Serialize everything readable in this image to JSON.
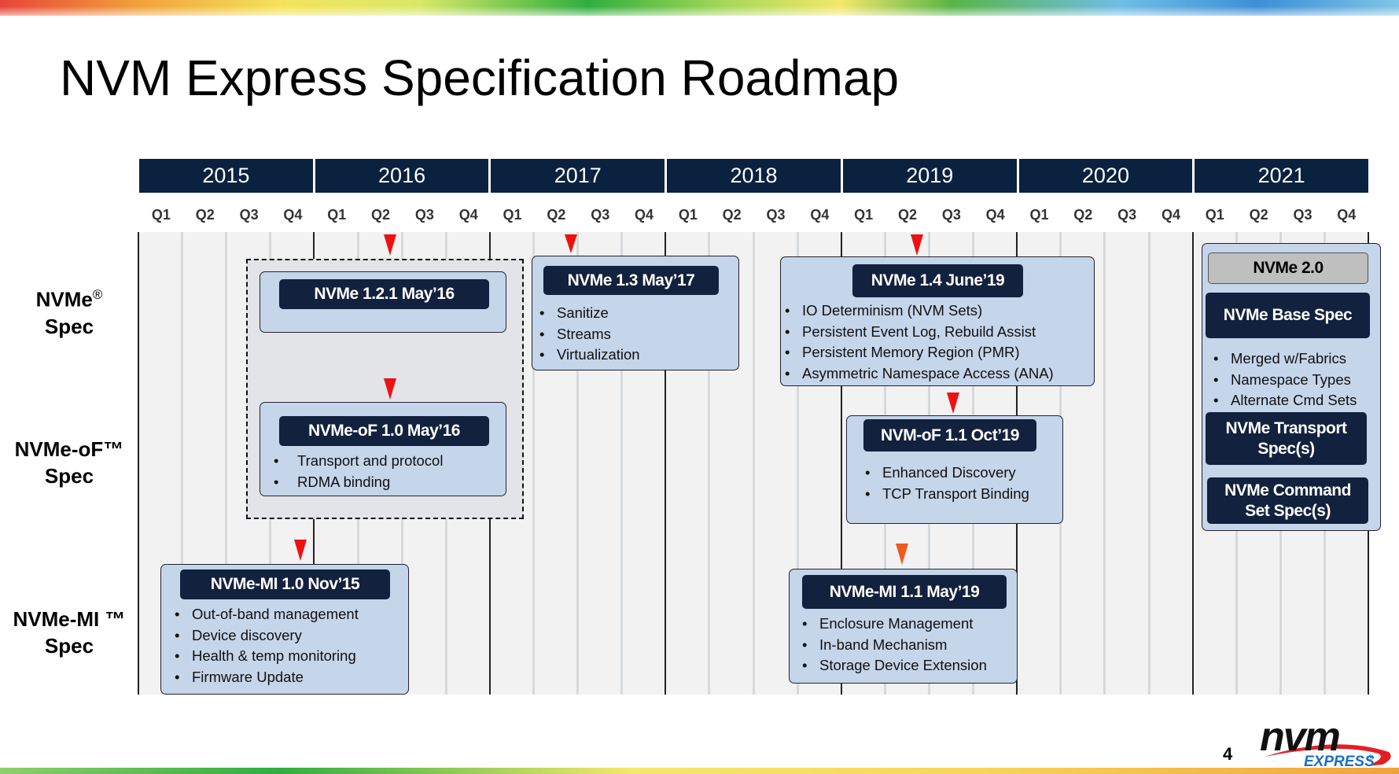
{
  "title": "NVM Express Specification Roadmap",
  "years": [
    "2015",
    "2016",
    "2017",
    "2018",
    "2019",
    "2020",
    "2021"
  ],
  "quarters": [
    "Q1",
    "Q2",
    "Q3",
    "Q4"
  ],
  "rows": {
    "nvme": {
      "name": "NVMe",
      "mark": "®",
      "line2": "Spec"
    },
    "nvmeof": {
      "name": "NVMe-oF™",
      "line2": "Spec"
    },
    "nvmemi": {
      "name": "NVMe-MI ™",
      "line2": "Spec"
    }
  },
  "releases": {
    "nvme_121": {
      "label": "NVMe 1.2.1 May’16",
      "bullets": []
    },
    "nvmeof_10": {
      "label": "NVMe-oF 1.0 May’16",
      "bullets": [
        "Transport and protocol",
        "RDMA binding"
      ]
    },
    "nvme_13": {
      "label": "NVMe 1.3 May’17",
      "bullets": [
        "Sanitize",
        "Streams",
        "Virtualization"
      ]
    },
    "nvme_14": {
      "label": "NVMe 1.4 June’19",
      "bullets": [
        "IO Determinism (NVM Sets)",
        "Persistent Event Log, Rebuild Assist",
        "Persistent Memory Region (PMR)",
        "Asymmetric Namespace Access (ANA)"
      ]
    },
    "nvmof_11": {
      "label": "NVM-oF 1.1 Oct’19",
      "bullets": [
        "Enhanced Discovery",
        "TCP Transport Binding"
      ]
    },
    "nvmemi_10": {
      "label": "NVMe-MI 1.0 Nov’15",
      "bullets": [
        "Out-of-band management",
        "Device discovery",
        "Health & temp monitoring",
        "Firmware Update"
      ]
    },
    "nvmemi_11": {
      "label": "NVMe-MI 1.1 May’19",
      "bullets": [
        "Enclosure Management",
        "In-band Mechanism",
        "Storage Device Extension"
      ]
    },
    "nvme_20": {
      "label": "NVMe 2.0",
      "base": "NVMe Base Spec",
      "bullets": [
        "Merged w/Fabrics",
        "Namespace Types",
        "Alternate Cmd Sets"
      ],
      "transport": "NVMe Transport Spec(s)",
      "command": "NVMe Command Set Spec(s)"
    }
  },
  "page_number": "4",
  "logo": {
    "word": "nvm",
    "sub": "EXPRESS",
    "mark": "®"
  },
  "colors": {
    "header": "#0a2240",
    "pill": "#12213d",
    "box": "#c5d5ea",
    "marker": "#ee1111",
    "marker_alt": "#f05a1e"
  }
}
